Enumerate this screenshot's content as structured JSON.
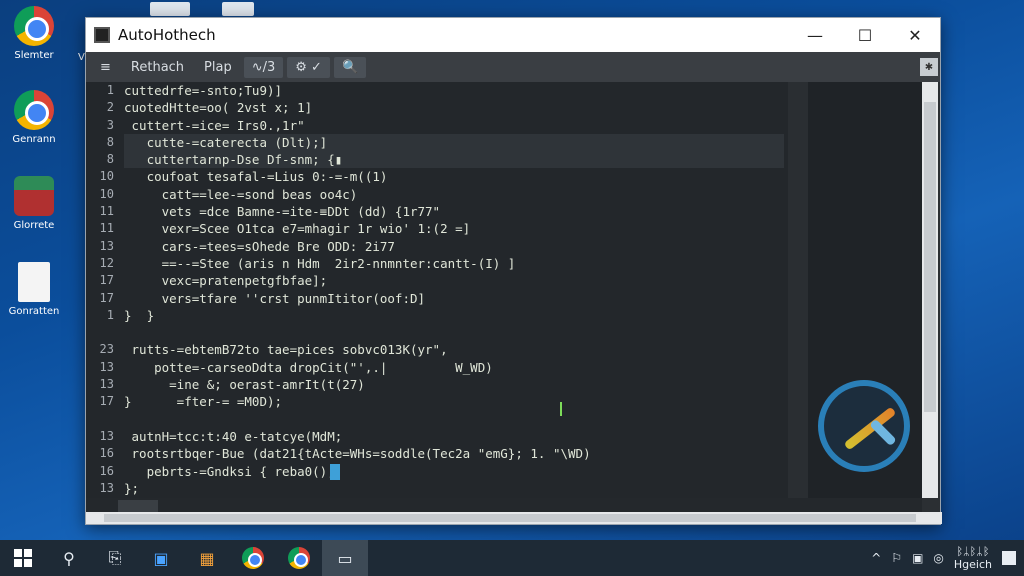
{
  "desktop": {
    "icons": [
      {
        "label": "Slemter",
        "icon": "chrome-icon"
      },
      {
        "label": "Genrann",
        "icon": "chrome-icon"
      },
      {
        "label": "Glorrete",
        "icon": "app-icon"
      },
      {
        "label": "Gonratten",
        "icon": "document-icon"
      }
    ],
    "partial_label": "V"
  },
  "window": {
    "title": "AutoHothech",
    "controls": {
      "minimize": "—",
      "maximize": "☐",
      "close": "✕"
    }
  },
  "toolbar": {
    "menu_glyph": "≡",
    "items": [
      "Rethach",
      "Plap",
      "∿/3",
      "⚙ ✓"
    ],
    "search_glyph": "🔍",
    "right_glyph": "✱"
  },
  "editor": {
    "line_numbers": [
      "1",
      "2",
      "3",
      "8",
      "8",
      "10",
      "10",
      "11",
      "11",
      "13",
      "12",
      "17",
      "17",
      "1",
      "",
      "23",
      "13",
      "13",
      "17",
      "",
      "13",
      "16",
      "16",
      "13",
      "13"
    ],
    "lines": [
      "cuttedrfe=-snto;⁠Tu9)]",
      "cuotedHtte=oo( 2vst x; 1]",
      " cuttert-=ice= Irs0.,1r\"",
      "   cutte-=caterecta (Dlt);]",
      "   cuttertarnp-Dse Df-snm; {▮",
      "   coufoat tesafal-=Lius 0:-=-m((1)",
      "     catt==lee-=sond beas oo4c)",
      "     vets =dce Bamne-=ite-≡DDt (dd) {1r77\"",
      "     vexr=Scee O1tca e7=mhagir 1r wio' 1:(2 =]",
      "     cars-=tees=sOhede Bre ODD: 2i77",
      "     ==--=Stee (aris n Hdm  2ir2-nnmnter:cantt-(I) ]",
      "     vexc=pratenpetgfbfae];",
      "     vers=tfare ''crst punmItitor(oof:D]",
      "}  }",
      "",
      " rutts-=ebtemB72to tae=pices sobvc013K(yr\",",
      "    potte=-carseoDdta dropCit(\"',.|         W_WD)",
      "      =ine &; oerast-amrIt(t(27)",
      "}      =fter-= =M0D);",
      "",
      " autnH=tcc:t:40 e-tatcye(MdM;",
      " rootsrtbqer-Bue (dat21{tActe=WHs=soddle(Tec2a \"emG}; 1. \"\\WD)",
      "   pebrts-=Gndksi { reba0();",
      "};",
      ""
    ]
  },
  "taskbar": {
    "tray_glyphs": [
      "^",
      "⚐",
      "▣",
      "◎"
    ],
    "clock_line1": "ᛒᛦᛒᛦᛒ",
    "clock_line2": "Hgeich"
  }
}
